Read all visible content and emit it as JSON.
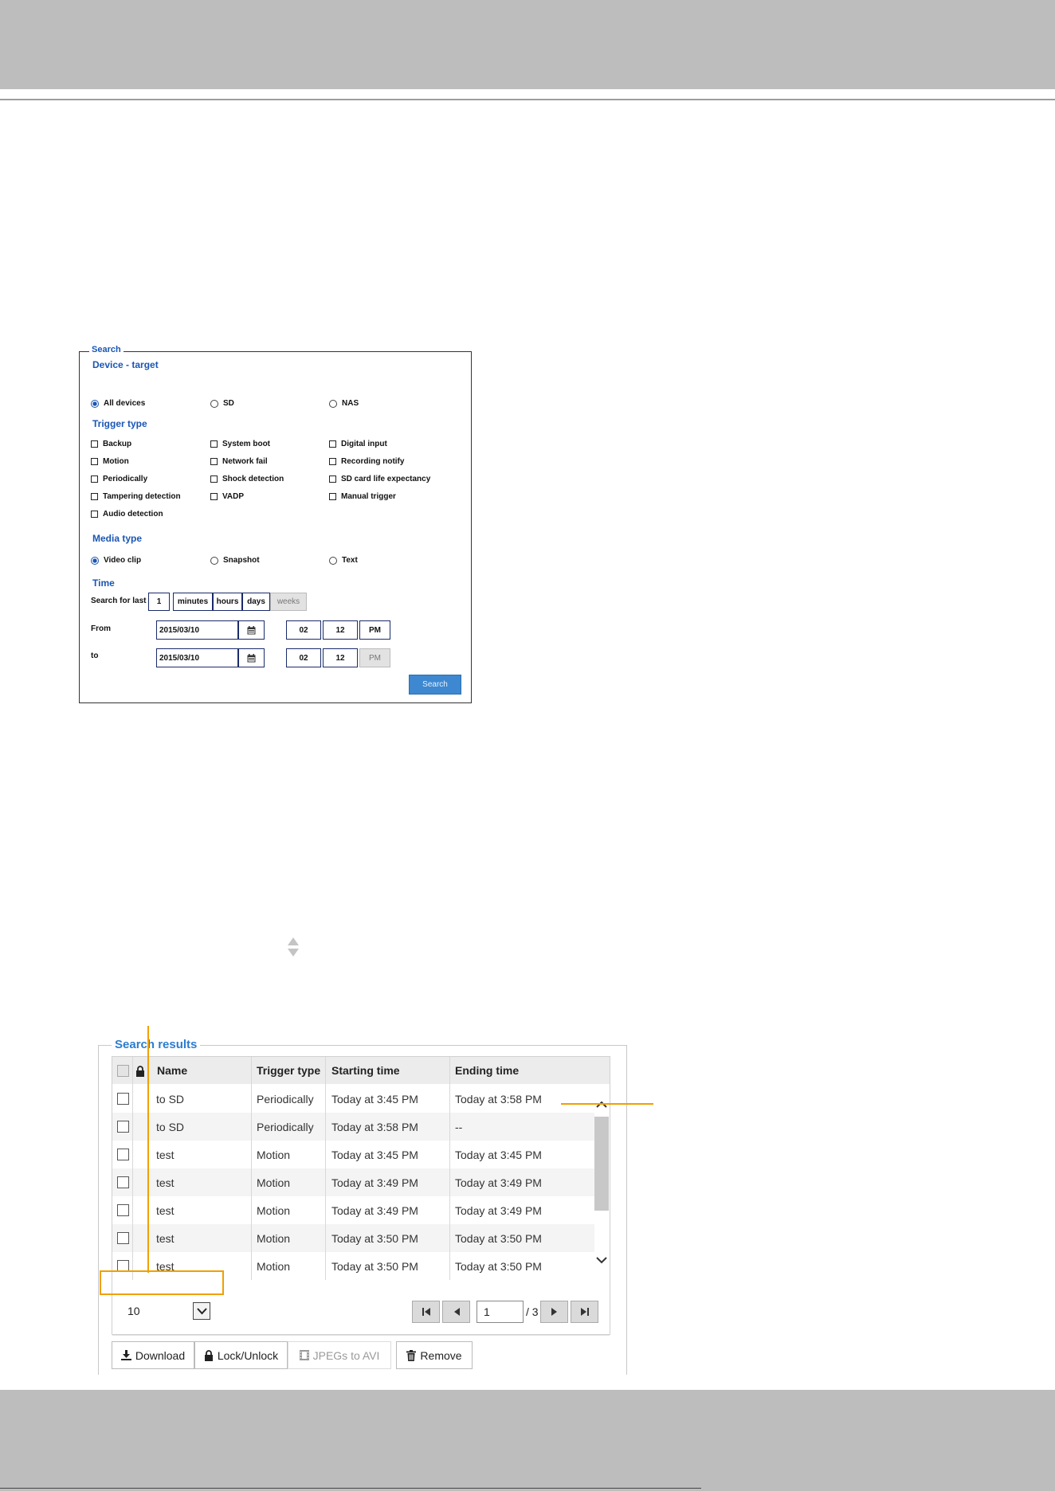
{
  "search": {
    "legend": "Search",
    "device_heading": "Device - target",
    "device_options": [
      "All devices",
      "SD",
      "NAS"
    ],
    "trigger_heading": "Trigger type",
    "trigger_options": [
      "Backup",
      "System boot",
      "Digital input",
      "Motion",
      "Network fail",
      "Recording notify",
      "Periodically",
      "Shock detection",
      "SD card life expectancy",
      "Tampering detection",
      "VADP",
      "Manual trigger",
      "Audio detection"
    ],
    "media_heading": "Media type",
    "media_options": [
      "Video clip",
      "Snapshot",
      "Text"
    ],
    "time_heading": "Time",
    "search_for_last_label": "Search for last",
    "search_for_last_value": "1",
    "units": [
      "minutes",
      "hours",
      "days",
      "weeks"
    ],
    "from_label": "From",
    "from_date": "2015/03/10",
    "from_hour": "02",
    "from_min": "12",
    "from_ampm": "PM",
    "to_label": "to",
    "to_date": "2015/03/10",
    "to_hour": "02",
    "to_min": "12",
    "to_ampm": "PM",
    "search_button": "Search"
  },
  "results": {
    "legend": "Search results",
    "columns": [
      "Name",
      "Trigger type",
      "Starting time",
      "Ending time"
    ],
    "rows": [
      {
        "name": "to SD",
        "trigger": "Periodically",
        "start": "Today at 3:45 PM",
        "end": "Today at 3:58 PM"
      },
      {
        "name": "to SD",
        "trigger": "Periodically",
        "start": "Today at 3:58 PM",
        "end": "--"
      },
      {
        "name": "test",
        "trigger": "Motion",
        "start": "Today at 3:45 PM",
        "end": "Today at 3:45 PM"
      },
      {
        "name": "test",
        "trigger": "Motion",
        "start": "Today at 3:49 PM",
        "end": "Today at 3:49 PM"
      },
      {
        "name": "test",
        "trigger": "Motion",
        "start": "Today at 3:49 PM",
        "end": "Today at 3:49 PM"
      },
      {
        "name": "test",
        "trigger": "Motion",
        "start": "Today at 3:50 PM",
        "end": "Today at 3:50 PM"
      },
      {
        "name": "test",
        "trigger": "Motion",
        "start": "Today at 3:50 PM",
        "end": "Today at 3:50 PM"
      }
    ],
    "per_page": "10",
    "page_current": "1",
    "page_total": "/ 3",
    "actions": {
      "download": "Download",
      "lock": "Lock/Unlock",
      "jpegs": "JPEGs to AVI",
      "remove": "Remove"
    }
  },
  "colors": {
    "band": "#bcbdbc",
    "accent_blue": "#2d7cd0",
    "callout_orange": "#f0a000"
  }
}
